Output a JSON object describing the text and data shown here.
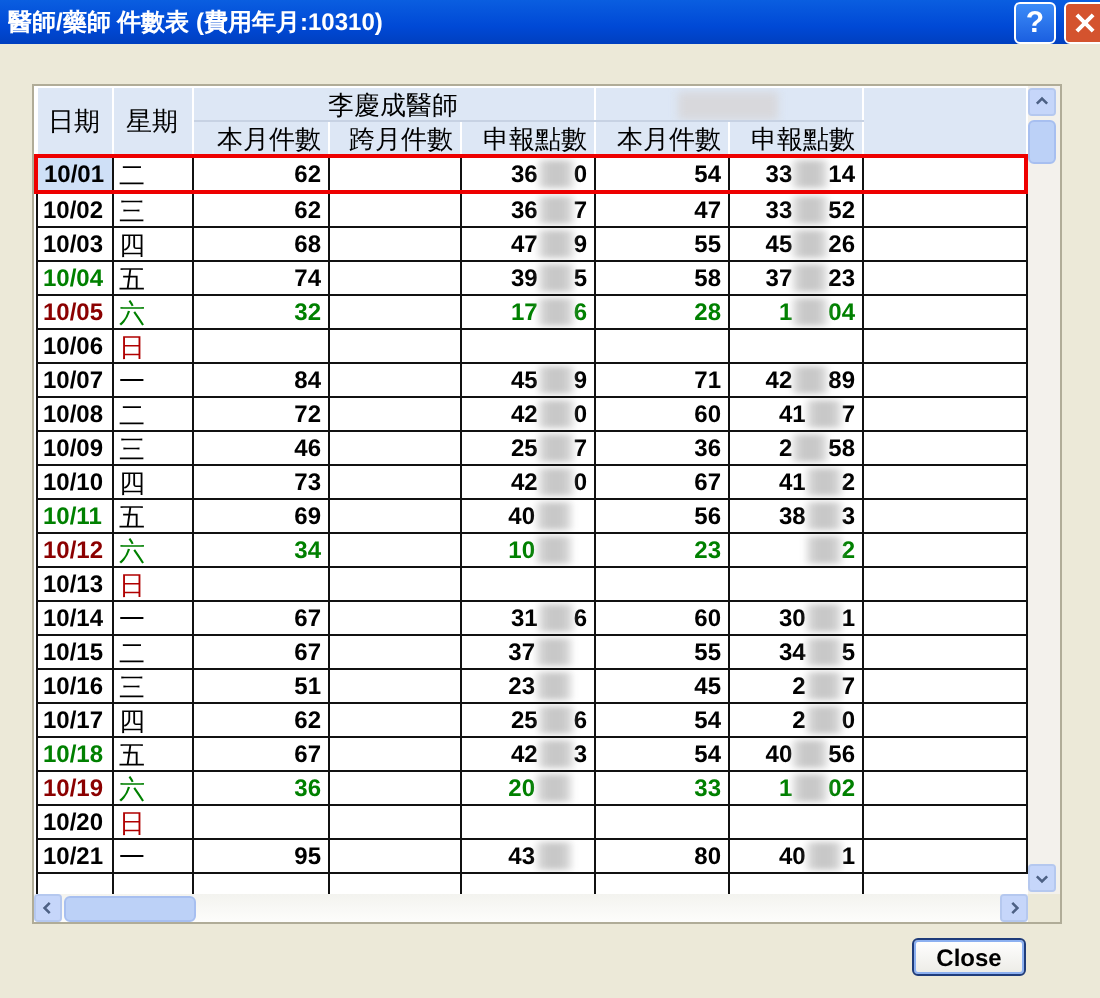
{
  "window": {
    "title": "醫師/藥師 件數表 (費用年月:10310)",
    "help_button": "?"
  },
  "table": {
    "columns": [
      "日期",
      "星期"
    ],
    "groups": [
      {
        "label": "李慶成醫師",
        "columns": [
          "本月件數",
          "跨月件數",
          "申報點數"
        ]
      },
      {
        "columns": [
          "本月件數",
          "申報點數"
        ]
      }
    ],
    "rows": [
      {
        "date": "10/01",
        "weekday": "二",
        "kind": "weekday",
        "selected": true,
        "count_1": "62",
        "points_1": {
          "start": "36",
          "end": "0"
        },
        "count_2": "54",
        "points_2": {
          "start": "33",
          "end": "14"
        }
      },
      {
        "date": "10/02",
        "weekday": "三",
        "kind": "weekday",
        "selected": false,
        "count_1": "62",
        "points_1": {
          "start": "36",
          "end": "7"
        },
        "count_2": "47",
        "points_2": {
          "start": "33",
          "end": "52"
        }
      },
      {
        "date": "10/03",
        "weekday": "四",
        "kind": "weekday",
        "selected": false,
        "count_1": "68",
        "points_1": {
          "start": "47",
          "end": "9"
        },
        "count_2": "55",
        "points_2": {
          "start": "45",
          "end": "26"
        }
      },
      {
        "date": "10/04",
        "weekday": "五",
        "kind": "friday",
        "selected": false,
        "count_1": "74",
        "points_1": {
          "start": "39",
          "end": "5"
        },
        "count_2": "58",
        "points_2": {
          "start": "37",
          "end": "23"
        }
      },
      {
        "date": "10/05",
        "weekday": "六",
        "kind": "saturday",
        "selected": false,
        "count_1": "32",
        "points_1": {
          "start": "17",
          "end": "6"
        },
        "count_2": "28",
        "points_2": {
          "start": "1",
          "end": "04"
        }
      },
      {
        "date": "10/06",
        "weekday": "日",
        "kind": "sunday",
        "selected": false
      },
      {
        "date": "10/07",
        "weekday": "一",
        "kind": "weekday",
        "selected": false,
        "count_1": "84",
        "points_1": {
          "start": "45",
          "end": "9"
        },
        "count_2": "71",
        "points_2": {
          "start": "42",
          "end": "89"
        }
      },
      {
        "date": "10/08",
        "weekday": "二",
        "kind": "weekday",
        "selected": false,
        "count_1": "72",
        "points_1": {
          "start": "42",
          "end": "0"
        },
        "count_2": "60",
        "points_2": {
          "start": "41",
          "end": "7"
        }
      },
      {
        "date": "10/09",
        "weekday": "三",
        "kind": "weekday",
        "selected": false,
        "count_1": "46",
        "points_1": {
          "start": "25",
          "end": "7"
        },
        "count_2": "36",
        "points_2": {
          "start": "2",
          "end": "58"
        }
      },
      {
        "date": "10/10",
        "weekday": "四",
        "kind": "weekday",
        "selected": false,
        "count_1": "73",
        "points_1": {
          "start": "42",
          "end": "0"
        },
        "count_2": "67",
        "points_2": {
          "start": "41",
          "end": "2"
        }
      },
      {
        "date": "10/11",
        "weekday": "五",
        "kind": "friday",
        "selected": false,
        "count_1": "69",
        "points_1": {
          "start": "40"
        },
        "count_2": "56",
        "points_2": {
          "start": "38",
          "end": "3"
        }
      },
      {
        "date": "10/12",
        "weekday": "六",
        "kind": "saturday",
        "selected": false,
        "count_1": "34",
        "points_1": {
          "start": "10"
        },
        "count_2": "23",
        "points_2": {
          "end": "2"
        }
      },
      {
        "date": "10/13",
        "weekday": "日",
        "kind": "sunday",
        "selected": false
      },
      {
        "date": "10/14",
        "weekday": "一",
        "kind": "weekday",
        "selected": false,
        "count_1": "67",
        "points_1": {
          "start": "31",
          "end": "6"
        },
        "count_2": "60",
        "points_2": {
          "start": "30",
          "end": "1"
        }
      },
      {
        "date": "10/15",
        "weekday": "二",
        "kind": "weekday",
        "selected": false,
        "count_1": "67",
        "points_1": {
          "start": "37"
        },
        "count_2": "55",
        "points_2": {
          "start": "34",
          "end": "5"
        }
      },
      {
        "date": "10/16",
        "weekday": "三",
        "kind": "weekday",
        "selected": false,
        "count_1": "51",
        "points_1": {
          "start": "23"
        },
        "count_2": "45",
        "points_2": {
          "start": "2",
          "end": "7"
        }
      },
      {
        "date": "10/17",
        "weekday": "四",
        "kind": "weekday",
        "selected": false,
        "count_1": "62",
        "points_1": {
          "start": "25",
          "end": "6"
        },
        "count_2": "54",
        "points_2": {
          "start": "2",
          "end": "0"
        }
      },
      {
        "date": "10/18",
        "weekday": "五",
        "kind": "friday",
        "selected": false,
        "count_1": "67",
        "points_1": {
          "start": "42",
          "end": "3"
        },
        "count_2": "54",
        "points_2": {
          "start": "40",
          "end": "56"
        }
      },
      {
        "date": "10/19",
        "weekday": "六",
        "kind": "saturday",
        "selected": false,
        "count_1": "36",
        "points_1": {
          "start": "20"
        },
        "count_2": "33",
        "points_2": {
          "start": "1",
          "end": "02"
        }
      },
      {
        "date": "10/20",
        "weekday": "日",
        "kind": "sunday",
        "selected": false
      },
      {
        "date": "10/21",
        "weekday": "一",
        "kind": "weekday",
        "selected": false,
        "count_1": "95",
        "points_1": {
          "start": "43"
        },
        "count_2": "80",
        "points_2": {
          "start": "40",
          "end": "1"
        }
      }
    ]
  },
  "buttons": [
    "Close"
  ]
}
